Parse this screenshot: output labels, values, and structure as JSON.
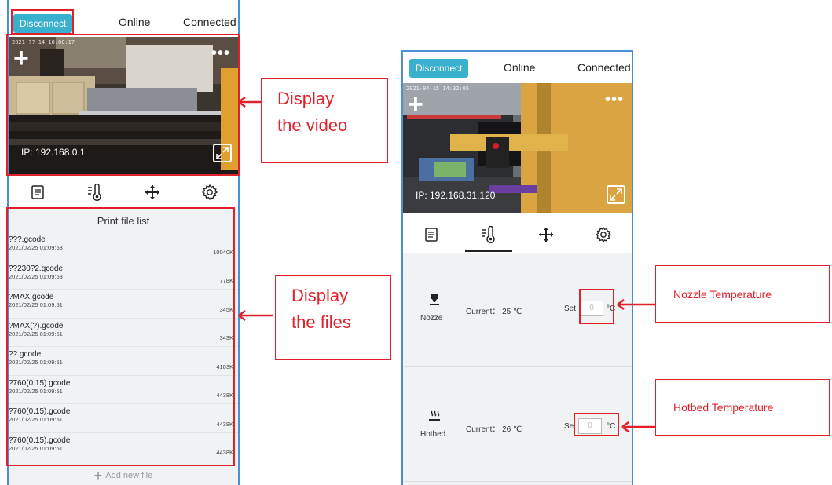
{
  "left_screen": {
    "topbar": {
      "disconnect_label": "Disconnect",
      "online_label": "Online",
      "connected_label": "Connected"
    },
    "video": {
      "timestamp": "2021-??-14 10:00:17",
      "ip_text": "IP: 192.168.0.1",
      "plus_icon": "plus-icon",
      "more_icon": "more-icon",
      "expand_icon": "expand-icon"
    },
    "tabs": [
      {
        "icon": "file-list-icon"
      },
      {
        "icon": "temperature-icon"
      },
      {
        "icon": "move-icon"
      },
      {
        "icon": "gear-icon"
      }
    ],
    "file_list": {
      "title": "Print file list",
      "files": [
        {
          "name": "???.gcode",
          "date": "2021/02/25 01:09:53",
          "size": "10040K"
        },
        {
          "name": "??230?2.gcode",
          "date": "2021/02/25 01:09:53",
          "size": "778K"
        },
        {
          "name": "?MAX.gcode",
          "date": "2021/02/25 01:09:51",
          "size": "345K"
        },
        {
          "name": "?MAX(?).gcode",
          "date": "2021/02/25 01:09:51",
          "size": "343K"
        },
        {
          "name": "??.gcode",
          "date": "2021/02/25 01:09:51",
          "size": "4103K"
        },
        {
          "name": "?760(0.15).gcode",
          "date": "2021/02/25 01:09:51",
          "size": "4438K"
        },
        {
          "name": "?760(0.15).gcode",
          "date": "2021/02/25 01:09:51",
          "size": "4438K"
        },
        {
          "name": "?760(0.15).gcode",
          "date": "2021/02/25 01:09:51",
          "size": "4438K"
        }
      ],
      "add_label": "Add new file"
    }
  },
  "right_screen": {
    "topbar": {
      "disconnect_label": "Disconnect",
      "online_label": "Online",
      "connected_label": "Connected"
    },
    "video": {
      "timestamp": "2021-04-15 14:32:05",
      "ip_text": "IP: 192.168.31.120"
    },
    "tabs": [
      {
        "icon": "file-list-icon"
      },
      {
        "icon": "temperature-icon",
        "active": true
      },
      {
        "icon": "move-icon"
      },
      {
        "icon": "gear-icon"
      }
    ],
    "nozzle": {
      "label": "Nozze",
      "current": "Current： 25 ℃",
      "set_label": "Set",
      "set_value": "0",
      "unit": "°C"
    },
    "hotbed": {
      "label": "Hotbed",
      "current": "Current： 26 ℃",
      "set_label": "Se",
      "set_value": "0",
      "unit": "°C"
    }
  },
  "annotations": {
    "display_video_line1": "Display",
    "display_video_line2": "the video",
    "display_files_line1": "Display",
    "display_files_line2": "the files",
    "nozzle_temperature": "Nozzle Temperature",
    "hotbed_temperature": "Hotbed Temperature",
    "color": "#e0202a"
  }
}
